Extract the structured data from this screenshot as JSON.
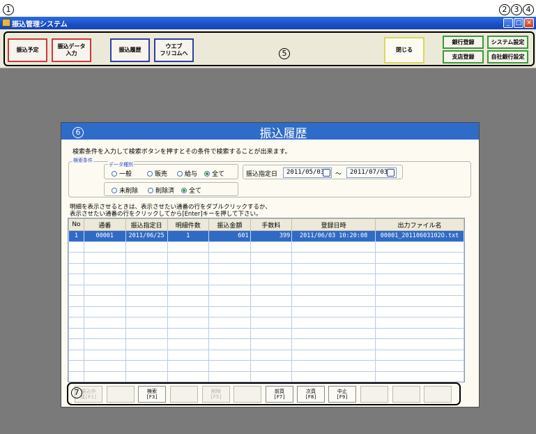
{
  "annotations": {
    "n1": "1",
    "n2": "2",
    "n3": "3",
    "n4": "4",
    "n5": "5",
    "n6": "6",
    "n7": "7"
  },
  "window": {
    "title": "振込管理システム",
    "minimize_label": "_",
    "maximize_label": "□",
    "close_label": "×"
  },
  "toolbar": {
    "transfer_schedule": "振込予定",
    "transfer_data_input": "振込データ\n入力",
    "transfer_history": "振込履歴",
    "web_fricom": "ウエブ\nフリコムへ",
    "close": "閉じる",
    "bank_register": "銀行登録",
    "branch_register": "支店登録",
    "system_settings": "システム設定",
    "own_bank_settings": "自社銀行設定"
  },
  "dialog": {
    "title": "振込履歴",
    "description": "検索条件を入力して検索ボタンを押すとその条件で検索することが出来ます。",
    "search_conditions_legend": "検索条件",
    "data_type_legend": "データ種別",
    "data_type_options": [
      "一般",
      "販売",
      "給与",
      "全て"
    ],
    "data_type_selected": "全て",
    "deletion_options": [
      "未削除",
      "削除済",
      "全て"
    ],
    "deletion_selected": "全て",
    "date_label": "振込指定日",
    "date_from": "2011/05/03",
    "date_sep": "〜",
    "date_to": "2011/07/03",
    "hint_line1": "明細を表示させるときは、表示させたい通番の行をダブルクリックするか、",
    "hint_line2": "表示させたい通番の行をクリックしてから[Enter]キーを押して下さい。"
  },
  "table": {
    "columns": [
      "No",
      "通番",
      "振込指定日",
      "明細件数",
      "振込金額",
      "手数料",
      "登録日時",
      "出力ファイル名"
    ],
    "rows": [
      [
        "1",
        "00001",
        "2011/06/25",
        "1",
        "601",
        "399",
        "2011/06/03 10:20:08",
        "00001_20110603102O.txt"
      ]
    ],
    "empty_rows": 14
  },
  "fkeys": [
    {
      "label": "振込作\n成[F1]",
      "enabled": false
    },
    {
      "label": "",
      "enabled": false
    },
    {
      "label": "検索\n[F3]",
      "enabled": true
    },
    {
      "label": "",
      "enabled": false
    },
    {
      "label": "削除\n[F5]",
      "enabled": false
    },
    {
      "label": "",
      "enabled": false
    },
    {
      "label": "前頁\n[F7]",
      "enabled": true
    },
    {
      "label": "次頁\n[F8]",
      "enabled": true
    },
    {
      "label": "中止\n[F9]",
      "enabled": true
    },
    {
      "label": "",
      "enabled": false
    },
    {
      "label": "",
      "enabled": false
    },
    {
      "label": "",
      "enabled": false
    }
  ],
  "colors": {
    "titlebar": "#1a4fc8",
    "dialog_header": "#2f6bc9",
    "selected_row": "#316ac5",
    "workspace": "#7a7a7a"
  }
}
